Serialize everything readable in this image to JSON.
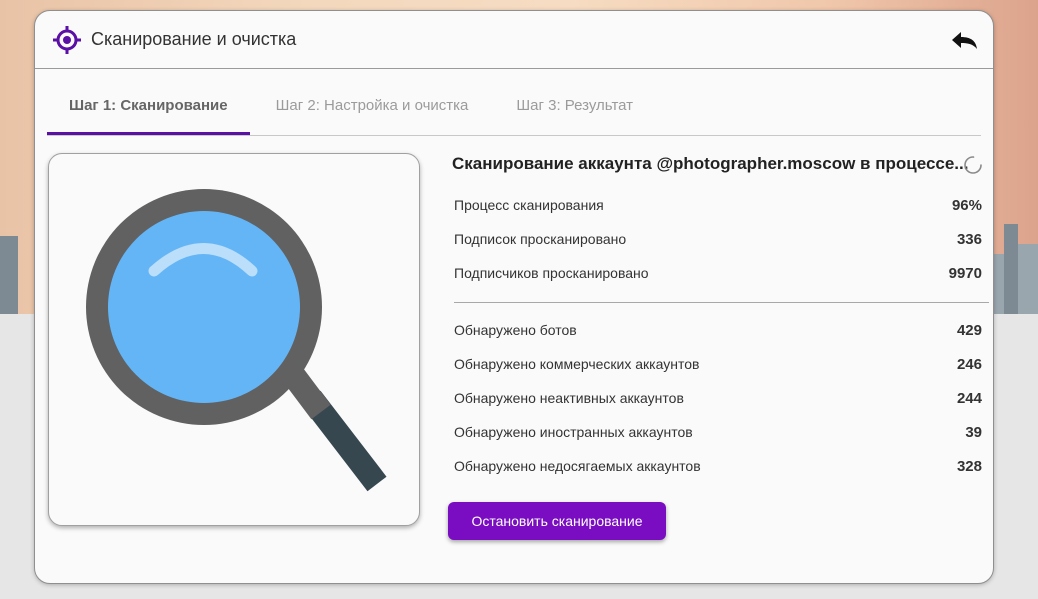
{
  "header": {
    "title": "Сканирование и очистка"
  },
  "tabs": [
    {
      "label": "Шаг 1: Сканирование",
      "active": true
    },
    {
      "label": "Шаг 2: Настройка и очистка",
      "active": false
    },
    {
      "label": "Шаг 3: Результат",
      "active": false
    }
  ],
  "scan": {
    "title": "Сканирование аккаунта @photographer.moscow в процессе...",
    "progress": [
      {
        "label": "Процесс сканирования",
        "value": "96%"
      },
      {
        "label": "Подписок просканировано",
        "value": "336"
      },
      {
        "label": "Подписчиков просканировано",
        "value": "9970"
      }
    ],
    "detected": [
      {
        "label": "Обнаружено ботов",
        "value": "429"
      },
      {
        "label": "Обнаружено коммерческих аккаунтов",
        "value": "246"
      },
      {
        "label": "Обнаружено неактивных аккаунтов",
        "value": "244"
      },
      {
        "label": "Обнаружено иностранных аккаунтов",
        "value": "39"
      },
      {
        "label": "Обнаружено недосягаемых аккаунтов",
        "value": "328"
      }
    ]
  },
  "actions": {
    "stop_label": "Остановить сканирование"
  },
  "icons": {
    "header": "target-icon",
    "back": "back-arrow-icon",
    "illustration": "magnifier-icon",
    "loading": "spinner-icon"
  },
  "colors": {
    "accent": "#7a0dc1",
    "tab_underline": "#5a0fa5",
    "lens": "#64b5f6",
    "frame": "#616161",
    "handle": "#37474f"
  }
}
